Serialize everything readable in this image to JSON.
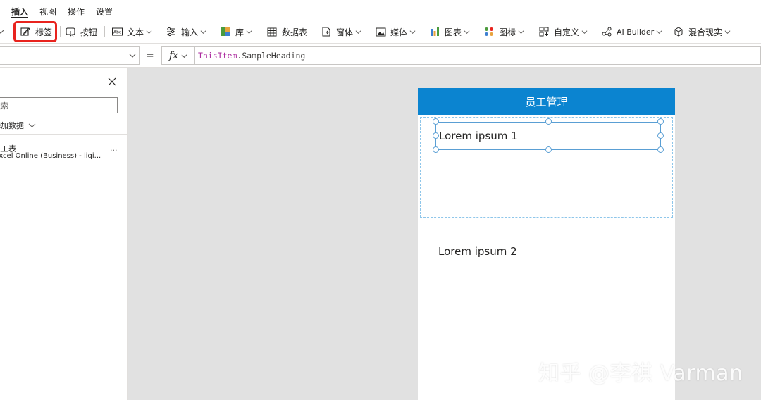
{
  "menu": {
    "tabs": [
      {
        "label": "插入",
        "active": true
      },
      {
        "label": "视图"
      },
      {
        "label": "操作"
      },
      {
        "label": "设置"
      }
    ]
  },
  "ribbon": {
    "items": [
      {
        "label": "标签",
        "icon": "edit-label-icon",
        "dropdown": false,
        "highlighted": true
      },
      {
        "label": "按钮",
        "icon": "button-icon",
        "dropdown": false
      },
      {
        "label": "文本",
        "icon": "text-icon",
        "dropdown": true
      },
      {
        "label": "输入",
        "icon": "input-icon",
        "dropdown": true
      },
      {
        "label": "库",
        "icon": "gallery-icon",
        "dropdown": true
      },
      {
        "label": "数据表",
        "icon": "data-table-icon",
        "dropdown": false
      },
      {
        "label": "窗体",
        "icon": "form-icon",
        "dropdown": true
      },
      {
        "label": "媒体",
        "icon": "media-icon",
        "dropdown": true
      },
      {
        "label": "图表",
        "icon": "chart-icon",
        "dropdown": true
      },
      {
        "label": "图标",
        "icon": "icons-icon",
        "dropdown": true
      },
      {
        "label": "自定义",
        "icon": "custom-icon",
        "dropdown": true
      },
      {
        "label": "AI Builder",
        "icon": "ai-builder-icon",
        "dropdown": true
      },
      {
        "label": "混合现实",
        "icon": "mixed-reality-icon",
        "dropdown": true
      }
    ],
    "highlight_color": "#e8231e"
  },
  "formula": {
    "property_value": "",
    "equals": "=",
    "fx_label": "fx",
    "token_item": "ThisItem",
    "token_rest": ".SampleHeading"
  },
  "left_panel": {
    "search_placeholder": "搜索",
    "add_data": "添加数据",
    "datasource": {
      "name": "员工表",
      "sub": "Excel Online (Business) - liqi...",
      "more": "..."
    }
  },
  "app": {
    "header_title": "员工管理",
    "header_color": "#0b84d0",
    "items": [
      "Lorem ipsum 1",
      "Lorem ipsum 2"
    ]
  },
  "watermark": "知乎 @李祺 Varman"
}
